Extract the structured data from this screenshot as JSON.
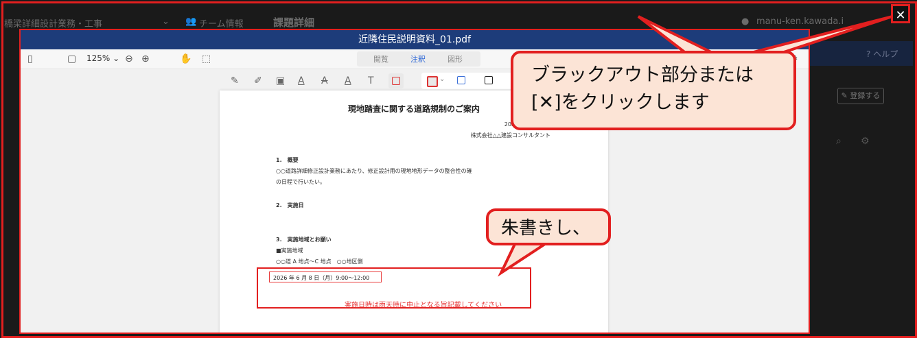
{
  "background_app": {
    "breadcrumb": "橋梁詳細設計業務・工事",
    "team_info": "チーム情報",
    "page_title": "課題詳細",
    "user": "manu-ken.kawada.i",
    "help": "ヘルプ",
    "side_button": "登録する"
  },
  "viewer": {
    "filename": "近隣住民説明資料_01.pdf",
    "zoom": "125%",
    "tabs": [
      {
        "label": "閲覧",
        "active": false
      },
      {
        "label": "注釈",
        "active": true
      },
      {
        "label": "図形",
        "active": false
      }
    ],
    "close_symbol": "✕"
  },
  "document": {
    "title": "現地踏査に関する道路規制のご案内",
    "date": "2026 年 6 月 1 日",
    "company": "株式会社△△建設コンサルタント",
    "section1_heading": "1.　概要",
    "section1_line1": "○○道路詳細修正設計業務にあたり、修正設計用の現地地形データの整合性の確",
    "section1_line2": "の日程で行いたい。",
    "section2_heading": "2.　実施日",
    "section2_date": "2026 年 6 月 8 日（月）9:00～12:00",
    "section3_heading": "3.　実施地域とお願い",
    "section3_sub": "■実施地域",
    "section3_line": "○○道 A 地点～C 地点　○○地区側",
    "annotation_note": "実施日時は雨天時に中止となる旨記載してください"
  },
  "callouts": {
    "main_line1": "ブラックアウト部分または",
    "main_line2": "[✕]をクリックします",
    "sub": "朱書きし、"
  },
  "colors": {
    "title_bar": "#1d3c7a",
    "highlight_red": "#e21f1f",
    "callout_fill": "#fce4d6"
  }
}
